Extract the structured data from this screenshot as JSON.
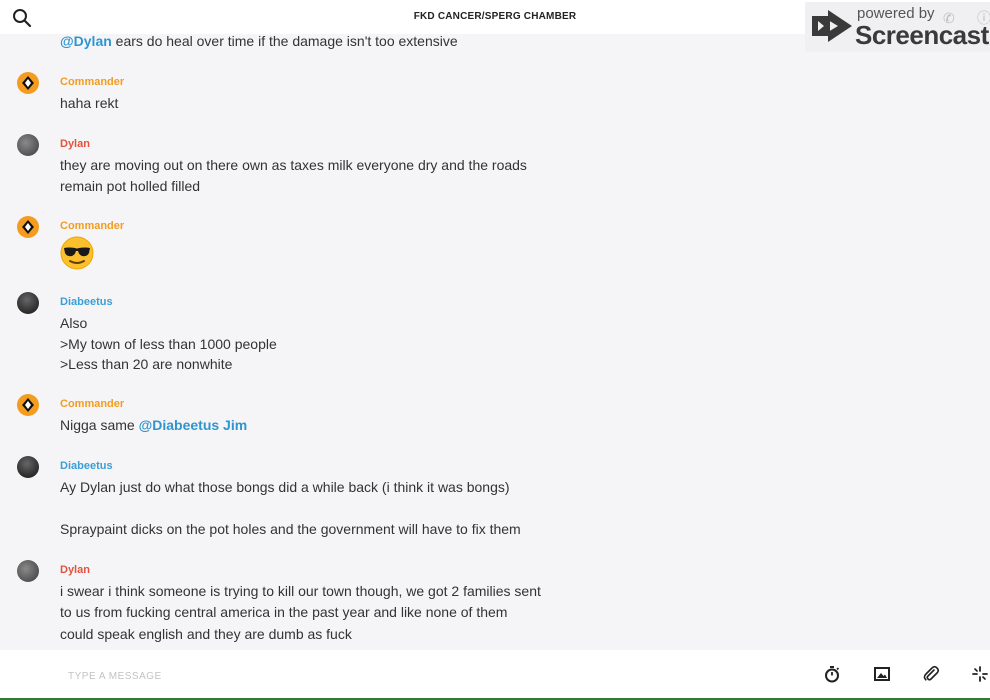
{
  "header": {
    "title": "FKD CANCER/SPERG CHAMBER",
    "search_icon": "search-icon"
  },
  "watermark": {
    "powered": "powered by",
    "brand": "Screencastify"
  },
  "messages": [
    {
      "author": "",
      "partial": true,
      "lines": [
        {
          "mention": "@Dylan",
          "text": " ears do heal over time if the damage isn't too extensive"
        }
      ]
    },
    {
      "author": "Commander",
      "lines": [
        {
          "text": "haha rekt"
        }
      ]
    },
    {
      "author": "Dylan",
      "lines": [
        {
          "text": "they are moving out on there own as taxes milk everyone dry and the roads"
        },
        {
          "text": "remain pot holled filled"
        }
      ]
    },
    {
      "author": "Commander",
      "emoji": "sunglasses-emoji"
    },
    {
      "author": "Diabeetus",
      "lines": [
        {
          "text": "Also"
        },
        {
          "text": ">My town of less than 1000 people"
        },
        {
          "text": ">Less than 20 are nonwhite"
        }
      ]
    },
    {
      "author": "Commander",
      "lines": [
        {
          "text": "Nigga same ",
          "mention": "@Diabeetus Jim"
        }
      ]
    },
    {
      "author": "Diabeetus",
      "lines": [
        {
          "text": "Ay Dylan just do what those bongs did a while back (i think it was bongs)"
        },
        {
          "text": "Spraypaint dicks on the pot holes and the government will have to fix them"
        }
      ]
    },
    {
      "author": "Dylan",
      "lines": [
        {
          "text": "i swear i think someone is trying to kill our town though, we got 2 families sent"
        },
        {
          "text": "to us from fucking central america in the past year and like none of them"
        },
        {
          "text": "could speak english and they are dumb as fuck"
        }
      ]
    }
  ],
  "composer": {
    "placeholder": "TYPE A MESSAGE",
    "icons": [
      "timer-icon",
      "image-icon",
      "paperclip-icon",
      "sparkle-icon"
    ]
  },
  "colors": {
    "commander": "#f39c1f",
    "dylan": "#e0533f",
    "diabeetus": "#3a9fd6",
    "mention": "#2f95cf"
  }
}
